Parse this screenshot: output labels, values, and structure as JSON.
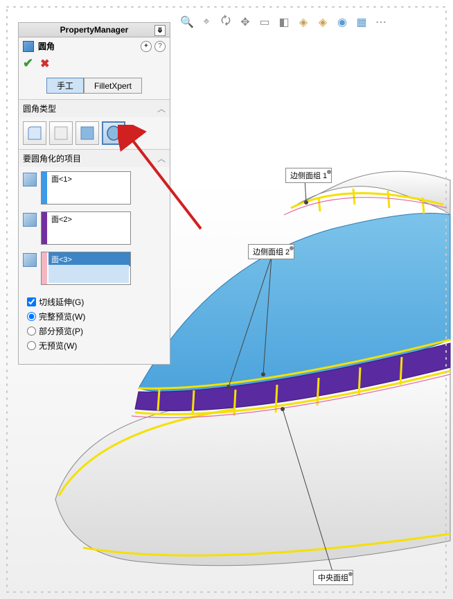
{
  "header": {
    "title": "PropertyManager"
  },
  "feature": {
    "name": "圆角"
  },
  "tabs": {
    "manual": "手工",
    "expert": "FilletXpert"
  },
  "sections": {
    "type_header": "圆角类型",
    "items_header": "要圆角化的项目"
  },
  "faces": {
    "f1": "面<1>",
    "f2": "面<2>",
    "f3": "面<3>"
  },
  "options": {
    "tangent": "切线延伸(G)",
    "full_preview": "完整预览(W)",
    "partial_preview": "部分预览(P)",
    "no_preview": "无预览(W)"
  },
  "callouts": {
    "side1": "边侧面组 1",
    "side2": "边侧面组 2",
    "center": "中央面组"
  }
}
